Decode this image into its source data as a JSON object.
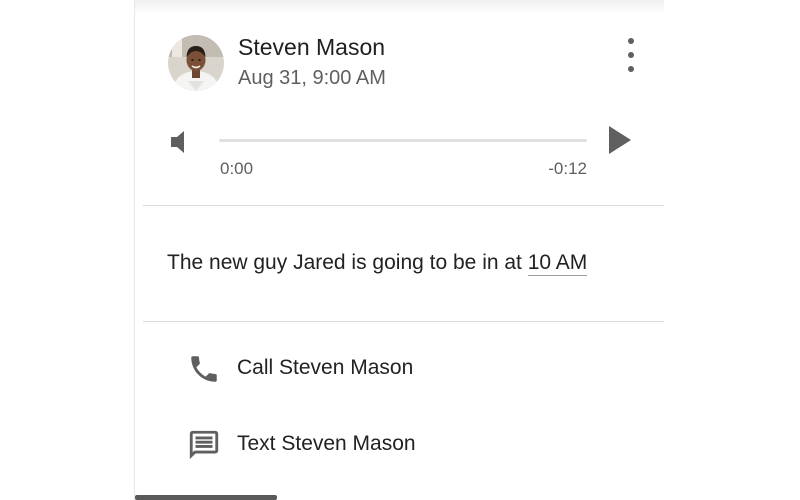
{
  "message": {
    "sender_name": "Steven Mason",
    "timestamp": "Aug 31, 9:00 AM",
    "menu_icon": "more-vert-icon"
  },
  "player": {
    "elapsed": "0:00",
    "remaining": "-0:12",
    "progress": 0,
    "volume_icon": "volume-icon",
    "play_icon": "play-icon"
  },
  "transcript": {
    "text_before": "The new guy Jared is going to be in at ",
    "time_link": "10 AM"
  },
  "actions": [
    {
      "label": "Call Steven Mason",
      "icon": "phone-icon"
    },
    {
      "label": "Text Steven Mason",
      "icon": "message-icon"
    }
  ],
  "colors": {
    "icon": "#5f5f5f",
    "divider": "#dcdcdc",
    "text": "#222222"
  }
}
